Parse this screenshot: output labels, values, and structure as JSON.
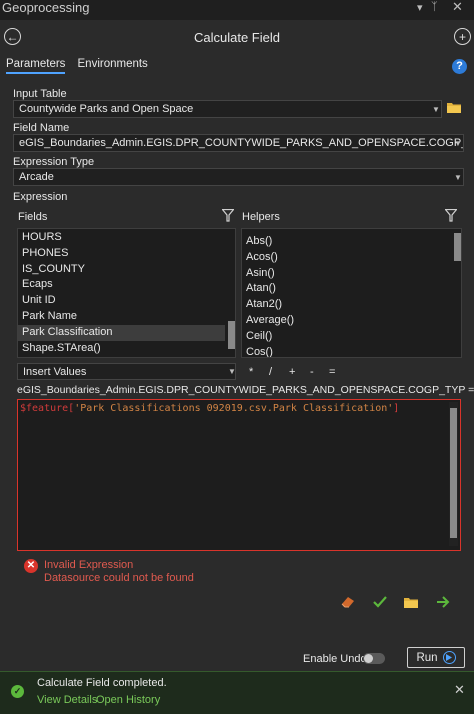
{
  "window": {
    "title": "Geoprocessing"
  },
  "tool": {
    "name": "Calculate Field"
  },
  "tabs": [
    {
      "label": "Parameters",
      "active": true
    },
    {
      "label": "Environments",
      "active": false
    }
  ],
  "input_table": {
    "label": "Input Table",
    "value": "Countywide Parks and Open Space"
  },
  "field_name": {
    "label": "Field Name",
    "value": "eGIS_Boundaries_Admin.EGIS.DPR_COUNTYWIDE_PARKS_AND_OPENSPACE.COGP_TYP"
  },
  "expression_type": {
    "label": "Expression Type",
    "value": "Arcade"
  },
  "expression": {
    "label": "Expression",
    "fields_label": "Fields",
    "helpers_label": "Helpers",
    "fields": [
      "HOURS",
      "PHONES",
      "IS_COUNTY",
      "Ecaps",
      "Unit ID",
      "Park Name",
      "Park Classification",
      "Shape.STArea()"
    ],
    "selected_field": "Park Classification",
    "helpers": [
      "Abs()",
      "Acos()",
      "Asin()",
      "Atan()",
      "Atan2()",
      "Average()",
      "Ceil()",
      "Cos()"
    ],
    "insert_values_label": "Insert Values",
    "operators": [
      "*",
      "/",
      "+",
      "-",
      "="
    ],
    "target_line": "eGIS_Boundaries_Admin.EGIS.DPR_COUNTYWIDE_PARKS_AND_OPENSPACE.COGP_TYP =",
    "code_prefix": "$feature[",
    "code_string": "'Park Classifications 092019.csv.Park Classification'",
    "code_suffix": "]"
  },
  "error": {
    "title": "Invalid Expression",
    "detail": "Datasource could not be found"
  },
  "footer": {
    "enable_undo_label": "Enable Undo",
    "enable_undo_on": false,
    "run_label": "Run"
  },
  "toast": {
    "message": "Calculate Field completed.",
    "view_details": "View Details",
    "open_history": "Open History"
  },
  "colors": {
    "accent": "#4fa3ff",
    "error": "#d9342b",
    "success": "#5cb83c",
    "string_literal": "#d28445",
    "variable": "#d13b3b"
  }
}
